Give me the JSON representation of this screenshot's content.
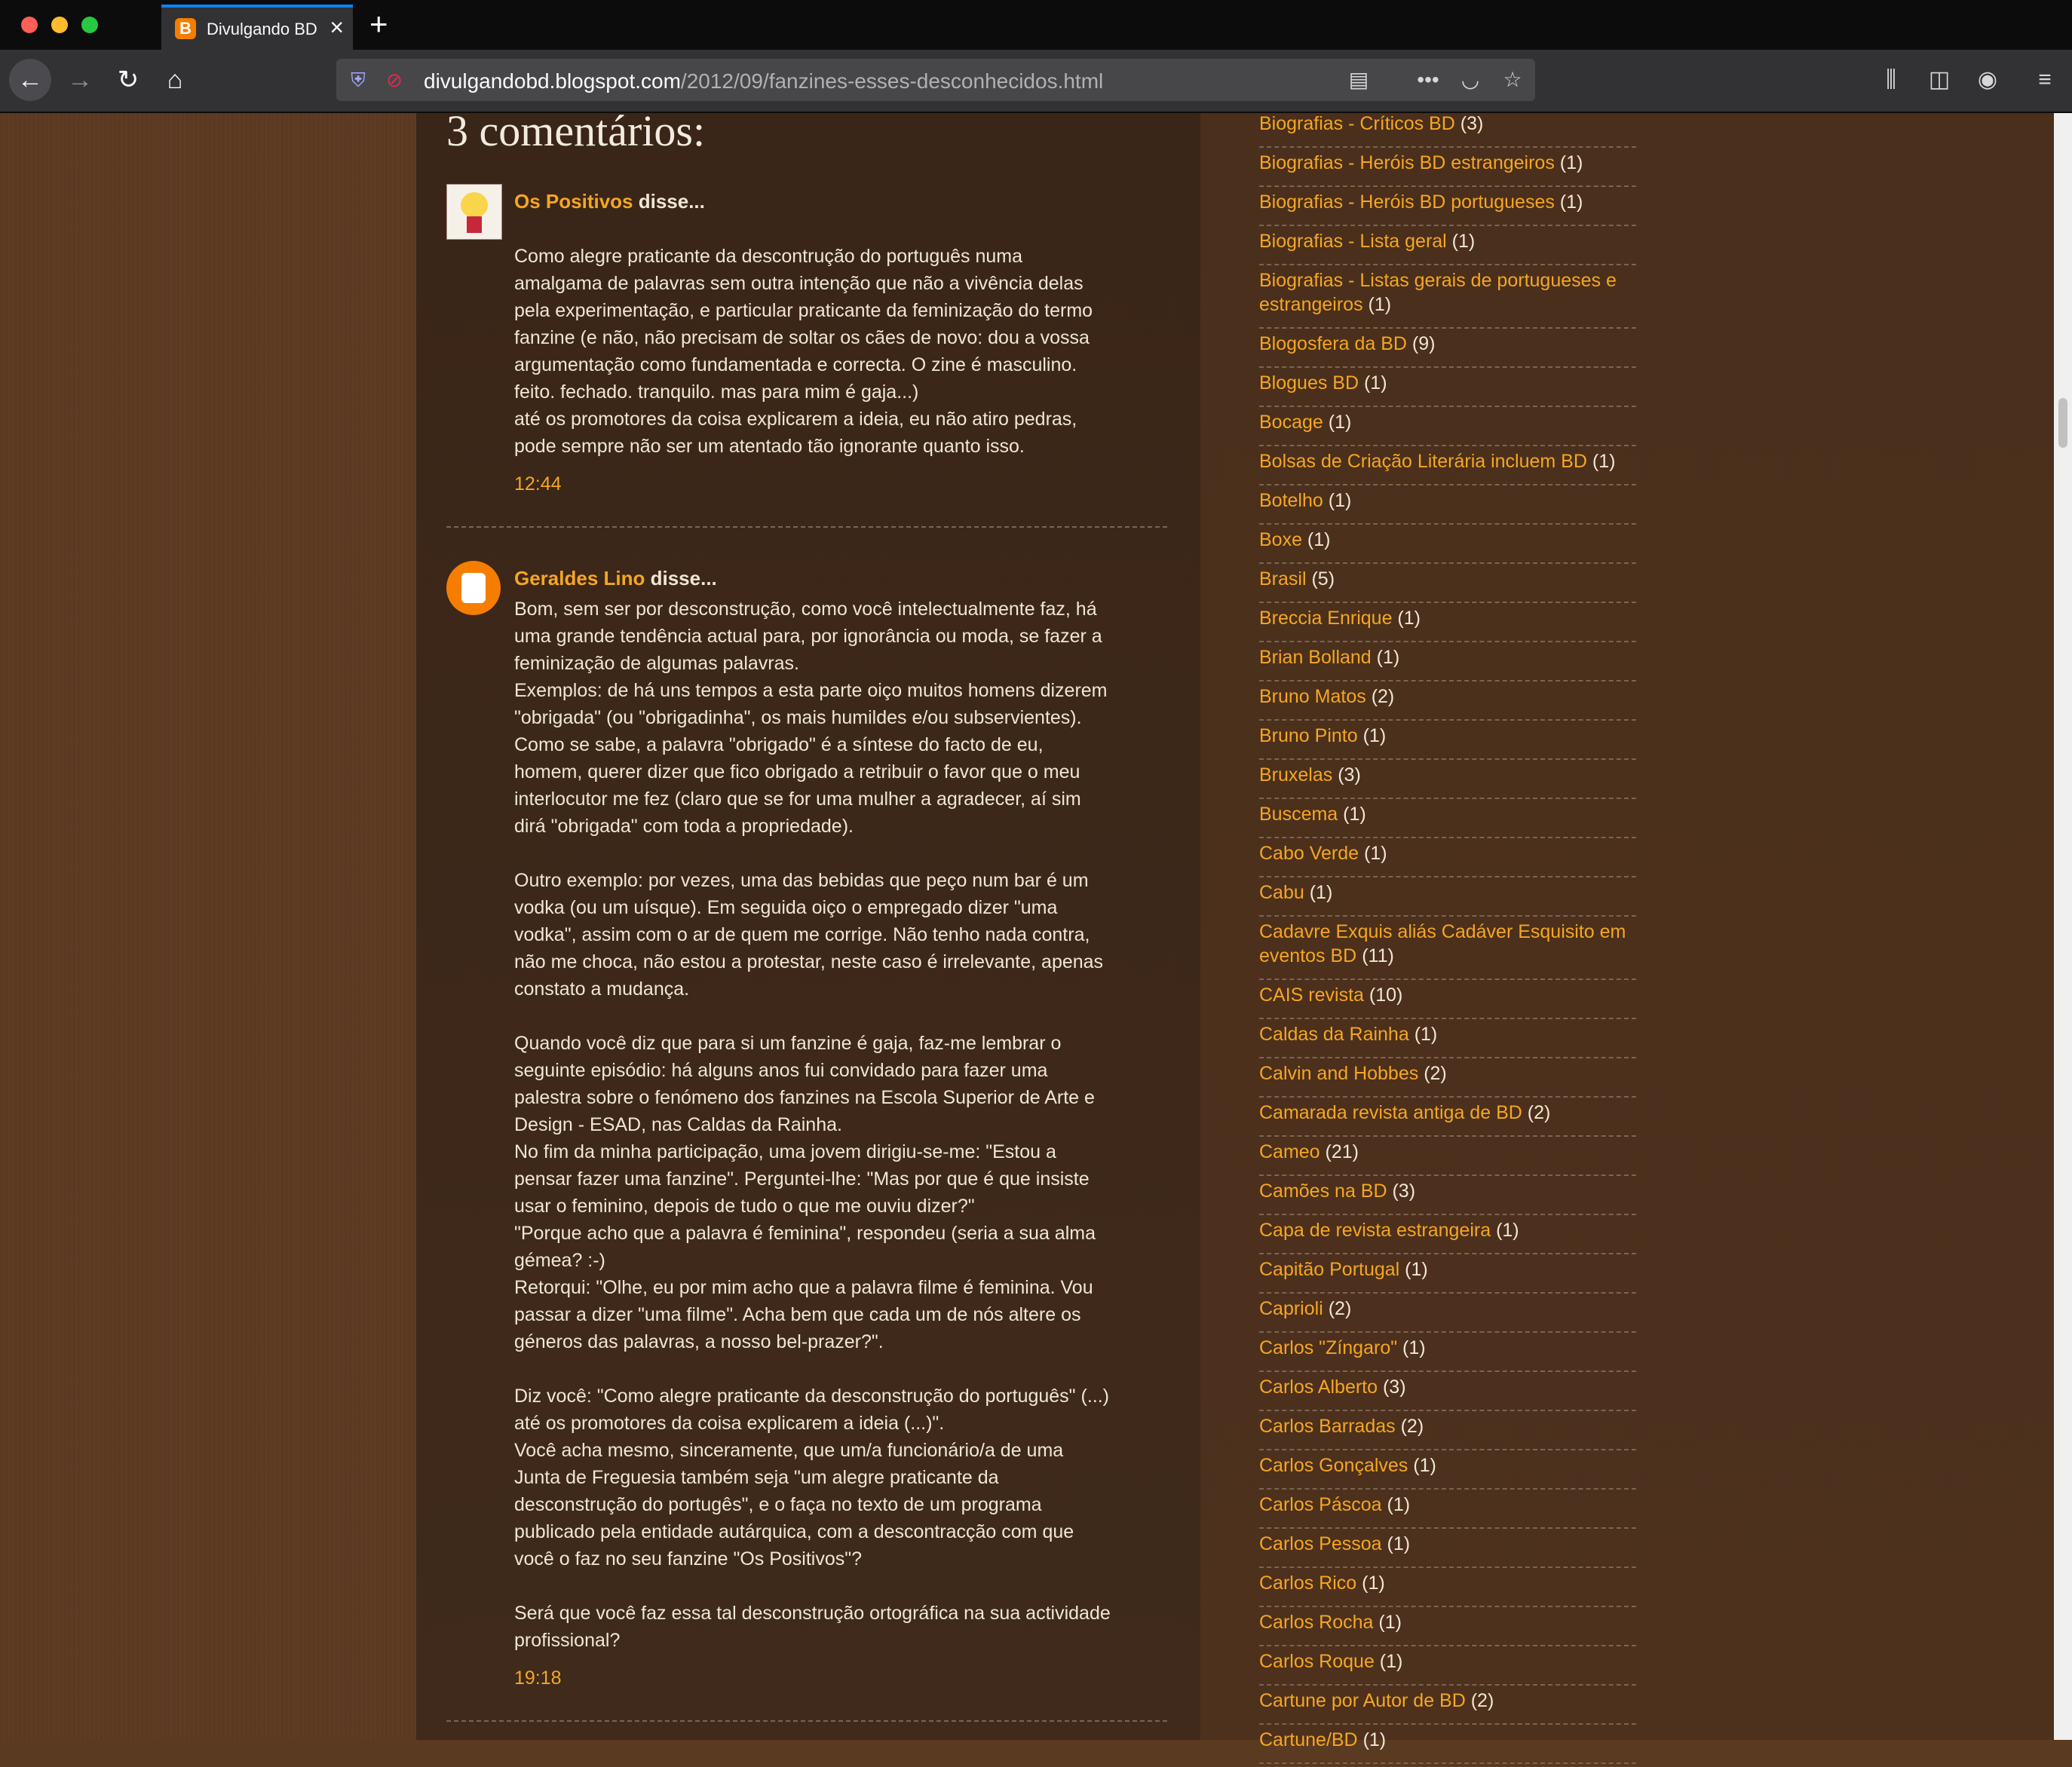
{
  "browser": {
    "tab_title": "Divulgando BD",
    "url_host": "divulgandobd.blogspot.com",
    "url_path": "/2012/09/fanzines-esses-desconhecidos.html"
  },
  "comments_section": {
    "title": "3 comentários:",
    "comments": [
      {
        "author": "Os Positivos",
        "said": " disse...",
        "body": "Como alegre praticante da descontrução do português numa\namalgama de palavras sem outra intenção que não a vivência delas\npela experimentação, e particular praticante da feminização do termo\nfanzine (e não, não precisam de soltar os cães de novo: dou a vossa\nargumentação como fundamentada e correcta. O zine é masculino.\nfeito. fechado. tranquilo. mas para mim é gaja...)\naté os promotores da coisa explicarem a ideia, eu não atiro pedras,\npode sempre não ser um atentado tão ignorante quanto isso.",
        "time": "12:44"
      },
      {
        "author": "Geraldes Lino",
        "said": " disse...",
        "body": "Bom, sem ser por desconstrução, como você intelectualmente faz, há\numa grande tendência actual para, por ignorância ou moda, se fazer a\nfeminização de algumas palavras.\nExemplos: de há uns tempos a esta parte oiço muitos homens dizerem\n\"obrigada\" (ou \"obrigadinha\", os mais humildes e/ou subservientes).\nComo se sabe, a palavra \"obrigado\" é a síntese do facto de eu,\nhomem, querer dizer que fico obrigado a retribuir o favor que o meu\ninterlocutor me fez (claro que se for uma mulher a agradecer, aí sim\ndirá \"obrigada\" com toda a propriedade).\n\nOutro exemplo: por vezes, uma das bebidas que peço num bar é um\nvodka (ou um uísque). Em seguida oiço o empregado dizer \"uma\nvodka\", assim com o ar de quem me corrige. Não tenho nada contra,\nnão me choca, não estou a protestar, neste caso é irrelevante, apenas\nconstato a mudança.\n\nQuando você diz que para si um fanzine é gaja, faz-me lembrar o\nseguinte episódio: há alguns anos fui convidado para fazer uma\npalestra sobre o fenómeno dos fanzines na Escola Superior de Arte e\nDesign - ESAD, nas Caldas da Rainha.\nNo fim da minha participação, uma jovem dirigiu-se-me: \"Estou a\npensar fazer uma fanzine\". Perguntei-lhe: \"Mas por que é que insiste\nusar o feminino, depois de tudo o que me ouviu dizer?\"\n\"Porque acho que a palavra é feminina\", respondeu (seria a sua alma\ngémea? :-)\nRetorqui: \"Olhe, eu por mim acho que a palavra filme é feminina. Vou\npassar a dizer \"uma filme\". Acha bem que cada um de nós altere os\ngéneros das palavras, a nosso bel-prazer?\".\n\nDiz você: \"Como alegre praticante da desconstrução do português\" (...)\naté os promotores da coisa explicarem a ideia (...)\".\nVocê acha mesmo, sinceramente, que um/a funcionário/a de uma\nJunta de Freguesia também seja \"um alegre praticante da\ndesconstrução do portugês\", e o faça no texto de um programa\npublicado pela entidade autárquica, com a descontracção com que\nvocê o faz no seu fanzine \"Os Positivos\"?\n\nSerá que você faz essa tal desconstrução ortográfica na sua actividade\nprofissional?",
        "time": "19:18"
      }
    ]
  },
  "sidebar": {
    "labels": [
      {
        "name": "Biografias - Críticos BD",
        "count": " (3)"
      },
      {
        "name": "Biografias - Heróis BD estrangeiros",
        "count": " (1)"
      },
      {
        "name": "Biografias - Heróis BD portugueses",
        "count": " (1)"
      },
      {
        "name": "Biografias - Lista geral",
        "count": " (1)"
      },
      {
        "name": "Biografias - Listas gerais de portugueses e estrangeiros",
        "count": " (1)"
      },
      {
        "name": "Blogosfera da BD",
        "count": " (9)"
      },
      {
        "name": "Blogues BD",
        "count": " (1)"
      },
      {
        "name": "Bocage",
        "count": " (1)"
      },
      {
        "name": "Bolsas de Criação Literária incluem BD",
        "count": " (1)"
      },
      {
        "name": "Botelho",
        "count": " (1)"
      },
      {
        "name": "Boxe",
        "count": " (1)"
      },
      {
        "name": "Brasil",
        "count": " (5)"
      },
      {
        "name": "Breccia Enrique",
        "count": " (1)"
      },
      {
        "name": "Brian Bolland",
        "count": " (1)"
      },
      {
        "name": "Bruno Matos",
        "count": " (2)"
      },
      {
        "name": "Bruno Pinto",
        "count": " (1)"
      },
      {
        "name": "Bruxelas",
        "count": " (3)"
      },
      {
        "name": "Buscema",
        "count": " (1)"
      },
      {
        "name": "Cabo Verde",
        "count": " (1)"
      },
      {
        "name": "Cabu",
        "count": " (1)"
      },
      {
        "name": "Cadavre Exquis aliás Cadáver Esquisito em eventos BD",
        "count": " (11)"
      },
      {
        "name": "CAIS revista",
        "count": " (10)"
      },
      {
        "name": "Caldas da Rainha",
        "count": " (1)"
      },
      {
        "name": "Calvin and Hobbes",
        "count": " (2)"
      },
      {
        "name": "Camarada revista antiga de BD",
        "count": " (2)"
      },
      {
        "name": "Cameo",
        "count": " (21)"
      },
      {
        "name": "Camões na BD",
        "count": " (3)"
      },
      {
        "name": "Capa de revista estrangeira",
        "count": " (1)"
      },
      {
        "name": "Capitão Portugal",
        "count": " (1)"
      },
      {
        "name": "Caprioli",
        "count": " (2)"
      },
      {
        "name": "Carlos \"Zíngaro\"",
        "count": " (1)"
      },
      {
        "name": "Carlos Alberto",
        "count": " (3)"
      },
      {
        "name": "Carlos Barradas",
        "count": " (2)"
      },
      {
        "name": "Carlos Gonçalves",
        "count": " (1)"
      },
      {
        "name": "Carlos Páscoa",
        "count": " (1)"
      },
      {
        "name": "Carlos Pessoa",
        "count": " (1)"
      },
      {
        "name": "Carlos Rico",
        "count": " (1)"
      },
      {
        "name": "Carlos Rocha",
        "count": " (1)"
      },
      {
        "name": "Carlos Roque",
        "count": " (1)"
      },
      {
        "name": "Cartune por Autor de BD",
        "count": " (2)"
      },
      {
        "name": "Cartune/BD",
        "count": " (1)"
      }
    ]
  },
  "icons": {
    "toolbar": [
      "back-icon",
      "forward-icon",
      "reload-icon",
      "home-icon",
      "tracking-shield-icon",
      "insecure-lock-icon",
      "reader-view-icon",
      "more-actions-icon",
      "pocket-icon",
      "bookmark-star-icon",
      "library-icon",
      "sidebar-icon",
      "account-icon",
      "menu-icon"
    ]
  },
  "colors": {
    "link": "#f5a623",
    "text": "#f0e6d5",
    "page_background": "#5b3a22",
    "main_column": "#3a2618",
    "sidebar_column": "#4a2f1c",
    "blogger_orange": "#f57d00"
  }
}
